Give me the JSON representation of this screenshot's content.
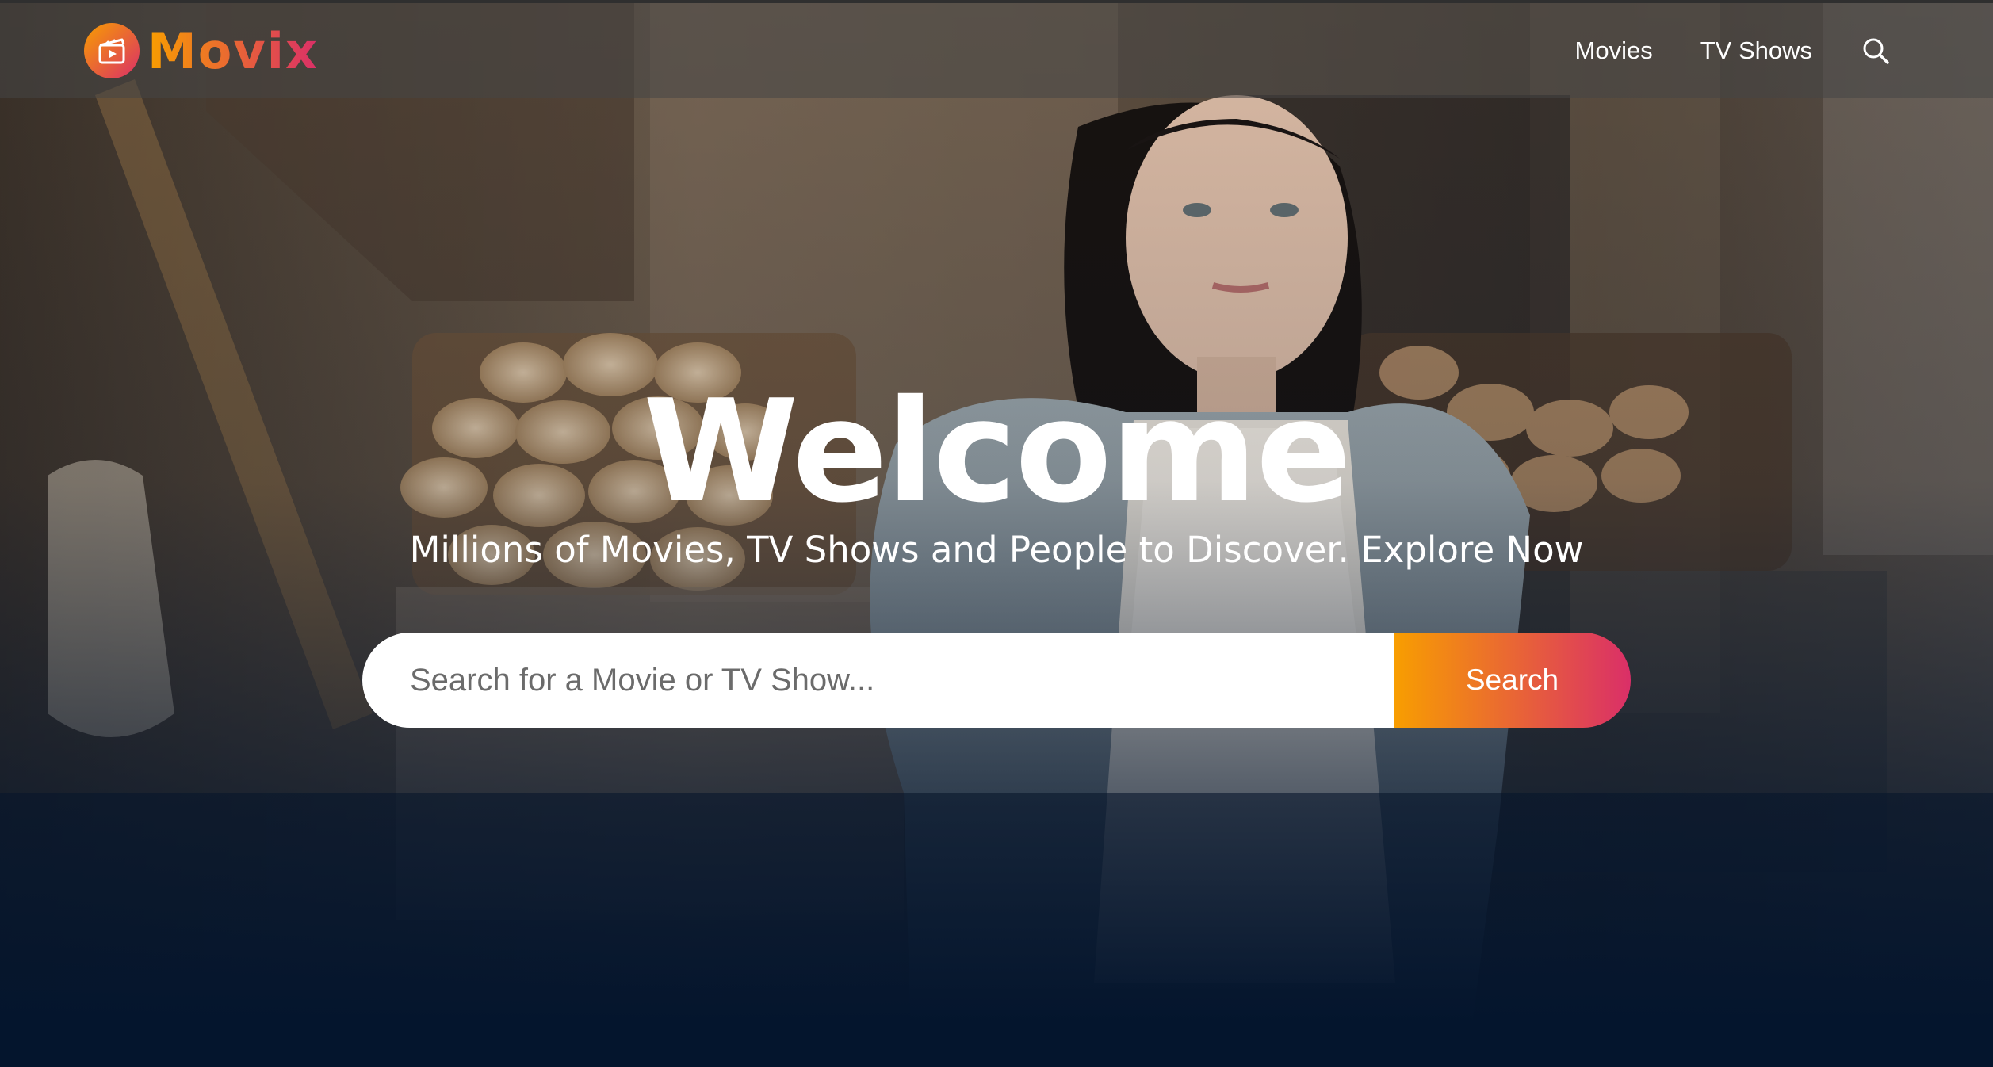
{
  "brand": {
    "name": "Movix",
    "logo_icon": "clapperboard-play-icon",
    "gradient_start": "#f89e00",
    "gradient_end": "#da2f68"
  },
  "nav": {
    "items": [
      {
        "label": "Movies"
      },
      {
        "label": "TV Shows"
      }
    ],
    "search_icon": "search-icon"
  },
  "hero": {
    "title": "Welcome",
    "subtitle": "Millions of Movies, TV Shows and People to Discover. Explore Now",
    "search": {
      "placeholder": "Search for a Movie or TV Show...",
      "button_label": "Search"
    }
  },
  "colors": {
    "page_background": "#04152d",
    "text": "#ffffff"
  }
}
